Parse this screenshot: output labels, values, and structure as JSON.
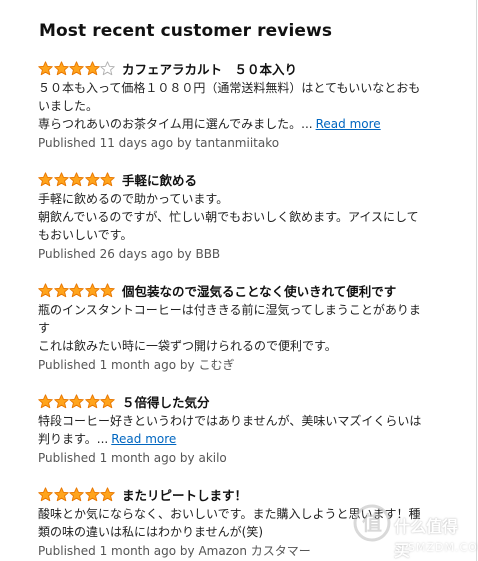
{
  "section": {
    "title": "Most recent customer reviews"
  },
  "colors": {
    "star_fill": "#FFA41C",
    "star_outline": "#E77600",
    "link": "#0066C0"
  },
  "reviews": [
    {
      "rating": 4,
      "title": "カフェアラカルト　５０本入り",
      "lines": [
        "５０本も入って価格１０８０円（通常送料無料）はとてもいいなとおも",
        "いました。",
        "専らつれあいのお茶タイム用に選んでみました。..."
      ],
      "read_more": "Read more",
      "meta": "Published 11 days ago by tantanmiitako"
    },
    {
      "rating": 5,
      "title": "手軽に飲める",
      "lines": [
        "手軽に飲めるので助かっています。",
        "朝飲んでいるのですが、忙しい朝でもおいしく飲めます。アイスにして",
        "もおいしいです。"
      ],
      "meta": "Published 26 days ago by BBB"
    },
    {
      "rating": 5,
      "title": "個包装なので湿気ることなく使いきれて便利です",
      "lines": [
        "瓶のインスタントコーヒーは付ききる前に湿気ってしまうことがありま",
        "す",
        "これは飲みたい時に一袋ずつ開けられるので便利です。"
      ],
      "meta": "Published 1 month ago by こむぎ"
    },
    {
      "rating": 5,
      "title": "５倍得した気分",
      "lines": [
        "特段コーヒー好きというわけではありませんが、美味いマズイくらいは",
        "判ります。..."
      ],
      "read_more": "Read more",
      "meta": "Published 1 month ago by akilo"
    },
    {
      "rating": 5,
      "title": "またリピートします！",
      "lines": [
        "酸味とか気にならなく、おいしいです。また購入しようと思います！種",
        "類の味の違いは私にはわかりませんが(笑)"
      ],
      "meta": "Published 1 month ago by Amazon カスタマー"
    }
  ],
  "watermark": {
    "text": "什么值得买",
    "sub": "SMZDM.COM"
  }
}
